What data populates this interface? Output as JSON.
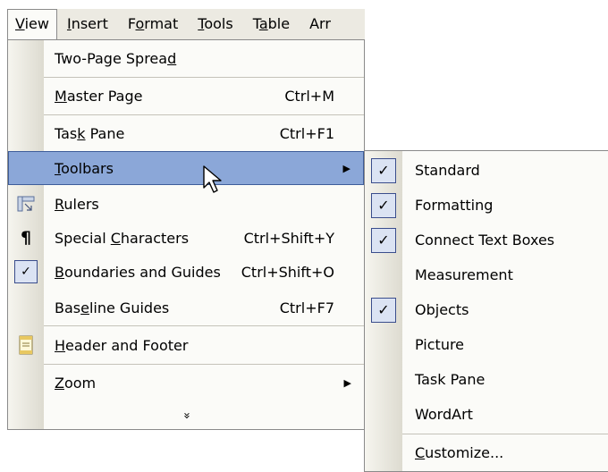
{
  "menubar": {
    "items": [
      {
        "label": "View",
        "underline": "V",
        "rest": "iew"
      },
      {
        "label": "Insert",
        "underline": "I",
        "rest": "nsert"
      },
      {
        "label": "Format",
        "pre": "F",
        "underline": "o",
        "rest": "rmat"
      },
      {
        "label": "Tools",
        "underline": "T",
        "rest": "ools"
      },
      {
        "label": "Table",
        "pre": "T",
        "underline": "a",
        "rest": "ble"
      },
      {
        "label": "Arr",
        "pre": "Arr",
        "underline": "",
        "rest": ""
      }
    ]
  },
  "view_menu": {
    "items": [
      {
        "pre": "Two-Page Sprea",
        "ul": "d",
        "post": "",
        "shortcut": ""
      },
      {
        "pre": "",
        "ul": "M",
        "post": "aster Page",
        "shortcut": "Ctrl+M"
      },
      {
        "pre": "Tas",
        "ul": "k",
        "post": " Pane",
        "shortcut": "Ctrl+F1"
      },
      {
        "pre": "",
        "ul": "T",
        "post": "oolbars",
        "shortcut": "",
        "arrow": "▶"
      },
      {
        "pre": "",
        "ul": "R",
        "post": "ulers",
        "shortcut": ""
      },
      {
        "pre": "Special ",
        "ul": "C",
        "post": "haracters",
        "shortcut": "Ctrl+Shift+Y"
      },
      {
        "pre": "",
        "ul": "B",
        "post": "oundaries and Guides",
        "shortcut": "Ctrl+Shift+O"
      },
      {
        "pre": "Bas",
        "ul": "e",
        "post": "line Guides",
        "shortcut": "Ctrl+F7"
      },
      {
        "pre": "",
        "ul": "H",
        "post": "eader and Footer",
        "shortcut": ""
      },
      {
        "pre": "",
        "ul": "Z",
        "post": "oom",
        "shortcut": "",
        "arrow": "▶"
      }
    ],
    "expand_glyph": "»"
  },
  "toolbars_submenu": {
    "items": [
      {
        "label": "Standard",
        "checked": true
      },
      {
        "label": "Formatting",
        "checked": true
      },
      {
        "label": "Connect Text Boxes",
        "checked": true
      },
      {
        "label": "Measurement",
        "checked": false
      },
      {
        "label": "Objects",
        "checked": true
      },
      {
        "label": "Picture",
        "checked": false
      },
      {
        "label": "Task Pane",
        "checked": false
      },
      {
        "label": "WordArt",
        "checked": false
      },
      {
        "pre": "",
        "ul": "C",
        "post": "ustomize...",
        "checked": false
      }
    ]
  },
  "glyphs": {
    "check": "✓",
    "pilcrow": "¶"
  },
  "colors": {
    "highlight": "#8ba7d8",
    "highlight_border": "#3e5d9a",
    "checkbox_bg": "#dbe3f3"
  }
}
